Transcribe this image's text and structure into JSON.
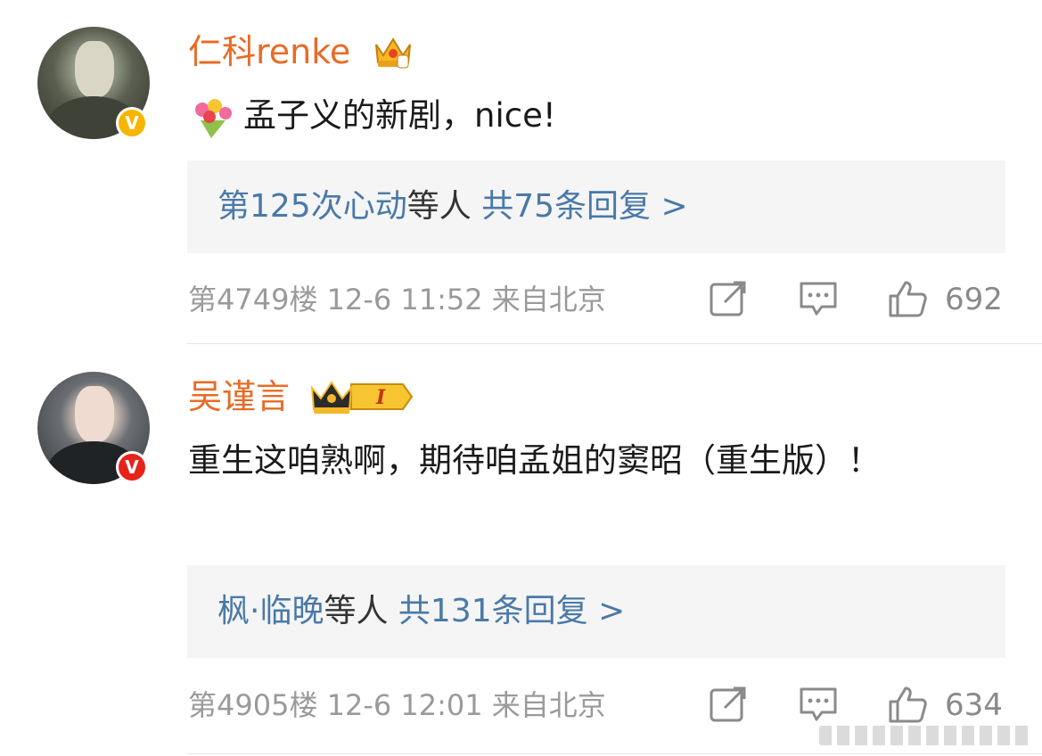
{
  "comments": [
    {
      "username": "仁科renke",
      "verified_badge": "V",
      "badge_color": "#f7b500",
      "content_icon": "bouquet-emoji",
      "content": "孟子义的新剧，nice!",
      "replies": {
        "replier": "第125次心动",
        "middle": "等人",
        "total": "共75条回复 >"
      },
      "meta": "第4749楼 12-6 11:52 来自北京",
      "likes": "692"
    },
    {
      "username": "吴谨言",
      "verified_badge": "V",
      "badge_color": "#e8231a",
      "level_badge": "I",
      "content": "重生这咱熟啊，期待咱孟姐的窦昭（重生版）！",
      "replies": {
        "replier": "枫·临晚",
        "middle": "等人",
        "total": "共131条回复 >"
      },
      "meta": "第4905楼 12-6 12:01 来自北京",
      "likes": "634"
    }
  ],
  "colors": {
    "username": "#e86b26",
    "link": "#4a79a8",
    "meta": "#9a9a9a",
    "reply_bg": "#f5f5f5"
  },
  "icons": [
    "share-icon",
    "comment-icon",
    "like-icon"
  ]
}
